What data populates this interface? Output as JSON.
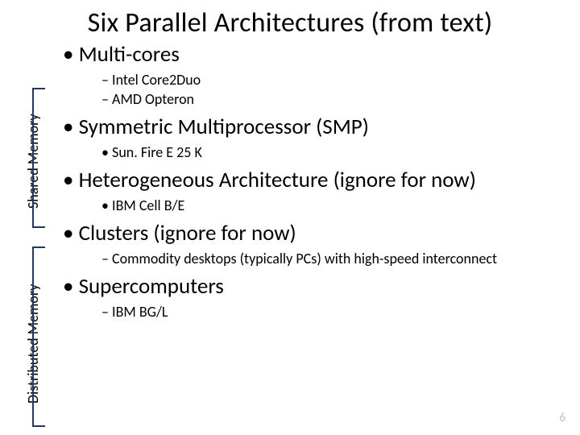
{
  "title": "Six Parallel Architectures (from text)",
  "labels": {
    "shared": "Shared Memory",
    "distributed": "Distributed Memory"
  },
  "items": {
    "multicores": {
      "text": "Multi-cores",
      "sub": [
        "Intel Core2Duo",
        "AMD Opteron"
      ]
    },
    "smp": {
      "text": "Symmetric Multiprocessor (SMP)",
      "sub": [
        "Sun. Fire E 25 K"
      ]
    },
    "hetero": {
      "text": "Heterogeneous Architecture (ignore for now)",
      "sub": [
        "IBM Cell B/E"
      ]
    },
    "clusters": {
      "text": "Clusters (ignore for now)",
      "sub": [
        "Commodity desktops (typically PCs) with high-speed interconnect"
      ]
    },
    "super": {
      "text": "Supercomputers",
      "sub": [
        "IBM BG/L"
      ]
    }
  },
  "page_number": "6"
}
